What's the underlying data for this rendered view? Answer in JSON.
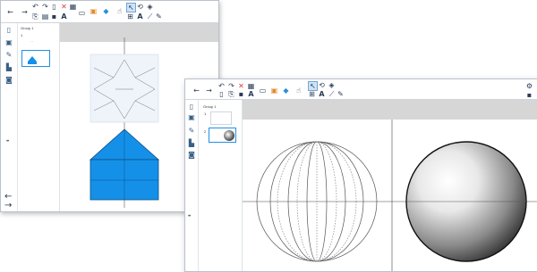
{
  "window_back": {
    "toolbar_icons": [
      "arrow-left-icon",
      "arrow-right-icon",
      "undo-icon",
      "redo-icon",
      "new-page-icon",
      "delete-icon",
      "grid-icon",
      "select-icon",
      "copy-icon",
      "paste-icon",
      "save-icon",
      "text-size-icon",
      "screen-icon",
      "image-icon",
      "shape-icon",
      "pointer-icon",
      "cursor-icon",
      "rotate-icon",
      "fill-icon",
      "table-icon",
      "text-icon",
      "line-icon",
      "pen-icon"
    ],
    "text_tool_label": "A",
    "group_label": "Group 1",
    "page_number": "1",
    "page_dots": ". .",
    "side_grip": "••",
    "colors": {
      "pyramid_fill": "#1590e8",
      "pyramid_stroke": "#0c4f86",
      "strip": "#d6d6d6"
    }
  },
  "window_front": {
    "toolbar_icons": [
      "arrow-left-icon",
      "arrow-right-icon",
      "undo-icon",
      "redo-icon",
      "delete-icon",
      "grid-icon",
      "screen-icon",
      "image-icon",
      "shape-icon",
      "pointer-icon",
      "cursor-icon",
      "rotate-icon",
      "fill-icon",
      "new-page-icon",
      "copy-icon",
      "save-icon",
      "text-size-icon",
      "table-icon",
      "text-icon",
      "line-icon",
      "pen-icon",
      "settings-icon",
      "layers-icon"
    ],
    "text_tool_label": "A",
    "group_label": "Group 1",
    "page_numbers": [
      "1",
      "2"
    ],
    "side_grip": "••",
    "colors": {
      "sphere_dark": "#3a3a3a",
      "strip": "#d6d6d6"
    }
  }
}
